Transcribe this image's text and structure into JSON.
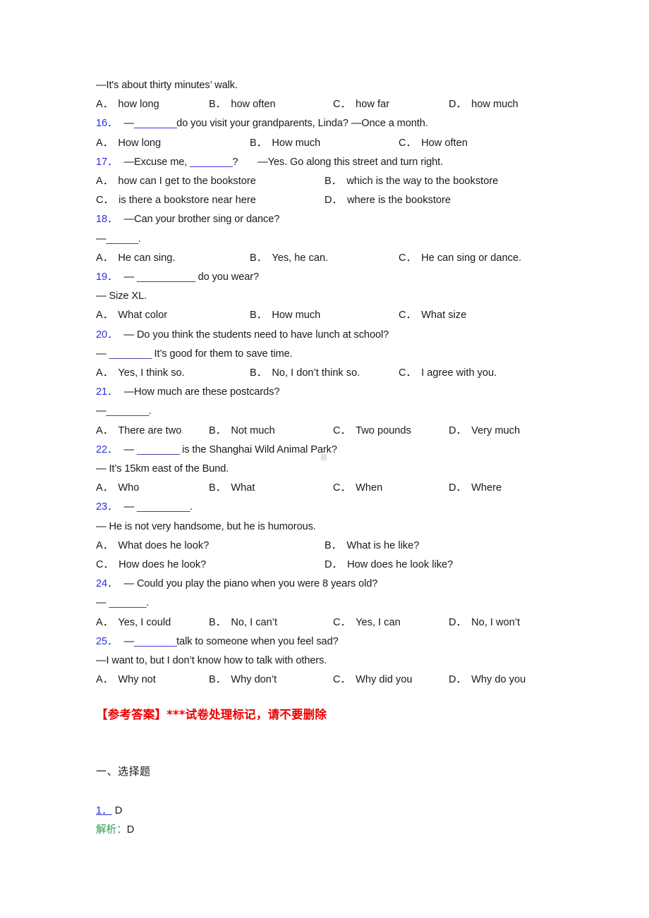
{
  "document": {
    "type": "english-exam-worksheet",
    "colors": {
      "question_number": "#2f2fd8",
      "answer_key_heading": "#ee0000",
      "explanation_label": "#2e9b4f",
      "body_text": "#1a1a1a",
      "page_background": "#ffffff"
    }
  },
  "questions": [
    {
      "lines": [
        "—It's about thirty minutes’ walk."
      ],
      "options_layout": "four",
      "options": [
        {
          "letter": "A．",
          "text": "how long"
        },
        {
          "letter": "B．",
          "text": "how often"
        },
        {
          "letter": "C．",
          "text": "how far"
        },
        {
          "letter": "D．",
          "text": "how much"
        }
      ]
    },
    {
      "number": "16．",
      "stem": "—________do you visit your grandparents, Linda? —Once a month.",
      "stem_pre": "—",
      "stem_blank": "________",
      "stem_post": "do you visit your grandparents, Linda? —Once a month.",
      "options_layout": "three",
      "options": [
        {
          "letter": "A．",
          "text": "How long"
        },
        {
          "letter": "B．",
          "text": "How much"
        },
        {
          "letter": "C．",
          "text": "How often"
        }
      ]
    },
    {
      "number": "17．",
      "stem_pre": "—Excuse me, ",
      "stem_blank": "________",
      "stem_post": "?       —Yes. Go along this street and turn right.",
      "options_layout": "two",
      "options": [
        {
          "letter": "A．",
          "text": "how can I get to the bookstore"
        },
        {
          "letter": "B．",
          "text": "which is the way to the bookstore"
        },
        {
          "letter": "C．",
          "text": "is there a bookstore near here"
        },
        {
          "letter": "D．",
          "text": "where is the bookstore"
        }
      ]
    },
    {
      "number": "18．",
      "stem_pre": "—Can your brother sing or dance?",
      "answer_line_pre": "—",
      "answer_line_blank": "______",
      "answer_line_post": ".",
      "options_layout": "three",
      "options": [
        {
          "letter": "A．",
          "text": "He can sing."
        },
        {
          "letter": "B．",
          "text": "Yes, he can."
        },
        {
          "letter": "C．",
          "text": "He can sing or dance."
        }
      ]
    },
    {
      "number": "19．",
      "stem_pre": "— ",
      "stem_blank": "___________",
      "stem_post": " do you wear?",
      "answer_line": "— Size XL.",
      "options_layout": "three",
      "options": [
        {
          "letter": "A．",
          "text": "What color"
        },
        {
          "letter": "B．",
          "text": "How much"
        },
        {
          "letter": "C．",
          "text": "What size"
        }
      ]
    },
    {
      "number": "20．",
      "stem": "— Do you think the students need to have lunch at school?",
      "answer_line_pre": "— ",
      "answer_line_blank": "________",
      "answer_line_post": " It’s good for them to save time.",
      "options_layout": "three",
      "options": [
        {
          "letter": "A．",
          "text": "Yes, I think so."
        },
        {
          "letter": "B．",
          "text": "No, I don’t think so."
        },
        {
          "letter": "C．",
          "text": "I agree with you."
        }
      ]
    },
    {
      "number": "21．",
      "stem": "—How much are these postcards?",
      "answer_line_pre": "—",
      "answer_line_blank": "________",
      "answer_line_post": ".",
      "options_layout": "four",
      "options": [
        {
          "letter": "A．",
          "text": "There are two"
        },
        {
          "letter": "B．",
          "text": "Not much"
        },
        {
          "letter": "C．",
          "text": "Two pounds"
        },
        {
          "letter": "D．",
          "text": "Very much"
        }
      ]
    },
    {
      "number": "22．",
      "stem_pre": "— ",
      "stem_blank": "________",
      "stem_post": " is the Shanghai Wild Animal Park?",
      "answer_line": "— It’s 15km east of the Bund.",
      "options_layout": "four",
      "options": [
        {
          "letter": "A．",
          "text": "Who"
        },
        {
          "letter": "B．",
          "text": "What"
        },
        {
          "letter": "C．",
          "text": "When"
        },
        {
          "letter": "D．",
          "text": "Where"
        }
      ]
    },
    {
      "number": "23．",
      "stem_pre": "— ",
      "stem_blank": "__________",
      "stem_post": ".",
      "answer_line": "— He is not very handsome, but he is humorous.",
      "options_layout": "two",
      "options": [
        {
          "letter": "A．",
          "text": "What does he look?"
        },
        {
          "letter": "B．",
          "text": "What is he like?"
        },
        {
          "letter": "C．",
          "text": "How does he look?"
        },
        {
          "letter": "D．",
          "text": "How does he look like?"
        }
      ]
    },
    {
      "number": "24．",
      "stem": "— Could you play the piano when you were 8 years old?",
      "answer_line_pre": "— ",
      "answer_line_blank": "_______",
      "answer_line_post": ".",
      "options_layout": "four",
      "options": [
        {
          "letter": "A．",
          "text": "Yes, I could"
        },
        {
          "letter": "B．",
          "text": "No, I can’t"
        },
        {
          "letter": "C．",
          "text": "Yes, I can"
        },
        {
          "letter": "D．",
          "text": "No, I won’t"
        }
      ]
    },
    {
      "number": "25．",
      "stem_pre": "—",
      "stem_blank": "________",
      "stem_post": "talk to someone when you feel sad?",
      "answer_line": "—I want to, but I don’t know how to talk with others.",
      "options_layout": "four",
      "options": [
        {
          "letter": "A．",
          "text": "Why not"
        },
        {
          "letter": "B．",
          "text": "Why don’t"
        },
        {
          "letter": "C．",
          "text": "Why did you"
        },
        {
          "letter": "D．",
          "text": "Why do you"
        }
      ]
    }
  ],
  "answer_key": {
    "heading": "【参考答案】***试卷处理标记，请不要删除",
    "section_title": "一、选择题",
    "items": [
      {
        "number": "1．",
        "answer": "D",
        "explanation_label": "解析：",
        "explanation": "D"
      }
    ]
  }
}
